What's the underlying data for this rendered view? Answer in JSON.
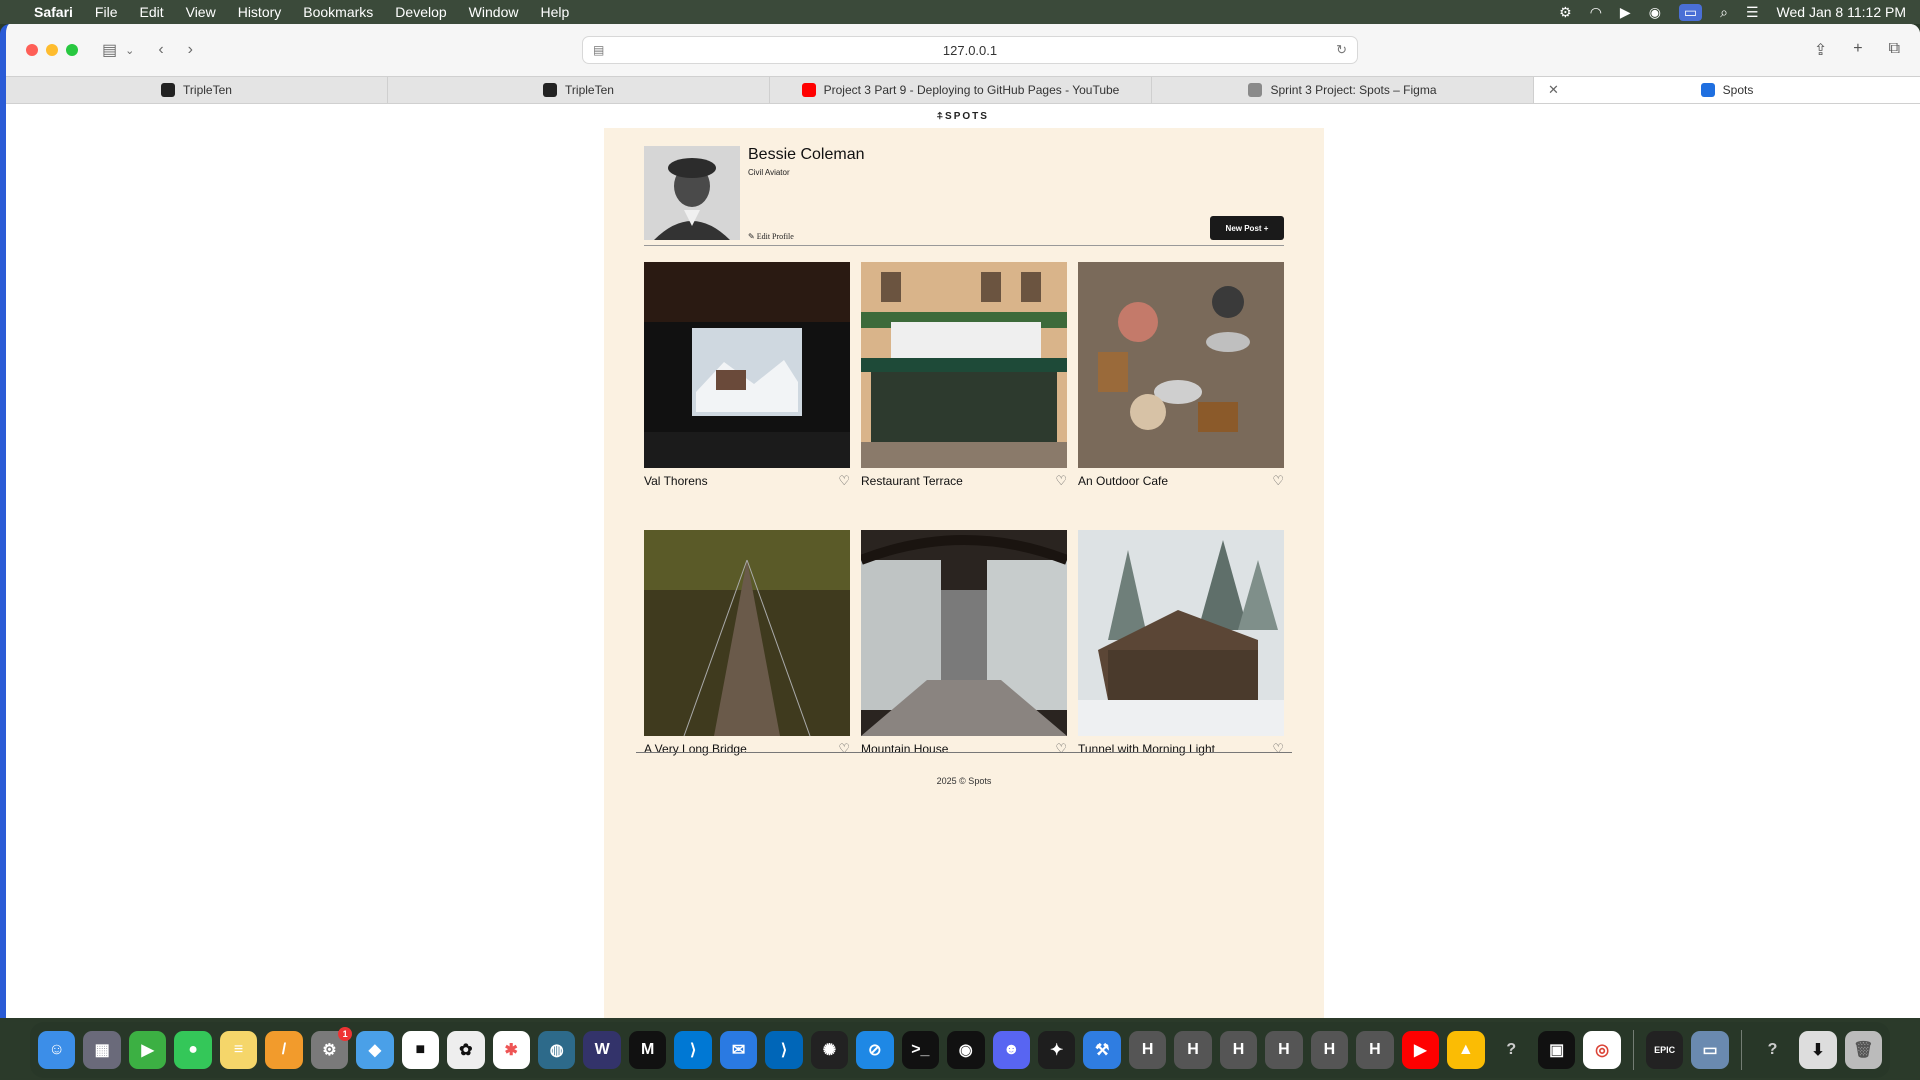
{
  "menubar": {
    "app": "Safari",
    "items": [
      "File",
      "Edit",
      "View",
      "History",
      "Bookmarks",
      "Develop",
      "Window",
      "Help"
    ],
    "clock": "Wed Jan 8  11:12 PM"
  },
  "browser": {
    "address": "127.0.0.1",
    "tabs": [
      {
        "label": "TripleTen",
        "icon": "tripleten-icon"
      },
      {
        "label": "TripleTen",
        "icon": "tripleten-icon"
      },
      {
        "label": "Project 3 Part 9 - Deploying to GitHub Pages - YouTube",
        "icon": "youtube-icon"
      },
      {
        "label": "Sprint 3 Project: Spots – Figma",
        "icon": "figma-icon"
      },
      {
        "label": "Spots",
        "icon": "spots-icon"
      }
    ]
  },
  "site": {
    "logo": "⍏SPOTS",
    "profile": {
      "name": "Bessie Coleman",
      "description": "Civil Aviator",
      "edit_label": "Edit Profile",
      "new_post_label": "New Post +"
    },
    "cards": [
      {
        "title": "Val Thorens"
      },
      {
        "title": "Restaurant Terrace"
      },
      {
        "title": "An Outdoor Cafe"
      },
      {
        "title": "A Very Long Bridge"
      },
      {
        "title": "Mountain House"
      },
      {
        "title": "Tunnel with Morning Light"
      }
    ],
    "footer": "2025 © Spots"
  },
  "colors": {
    "page_bg": "#fbf1e1",
    "button_dark": "#1a1a1a",
    "accent_blue": "#2a5bd6"
  },
  "dock": {
    "icons": [
      "finder-icon",
      "launchpad-icon",
      "facetime-icon",
      "messages-icon",
      "notes-icon",
      "pages-icon",
      "settings-icon",
      "app-icon",
      "app-icon",
      "app-icon",
      "app-icon",
      "app-icon",
      "app-icon",
      "app-icon",
      "vscode-icon",
      "mail-icon",
      "vscode-icon",
      "chatgpt-icon",
      "safari-icon",
      "terminal-icon",
      "github-icon",
      "discord-icon",
      "figma-icon",
      "xcode-icon",
      "h-icon",
      "h-icon",
      "h-icon",
      "h-icon",
      "h-icon",
      "h-icon",
      "youtube-icon",
      "app-icon",
      "help-icon",
      "app-icon",
      "chrome-icon",
      "epic-games-icon",
      "app-icon",
      "help-icon",
      "downloads-icon",
      "trash-icon"
    ],
    "settings_badge": "1"
  }
}
